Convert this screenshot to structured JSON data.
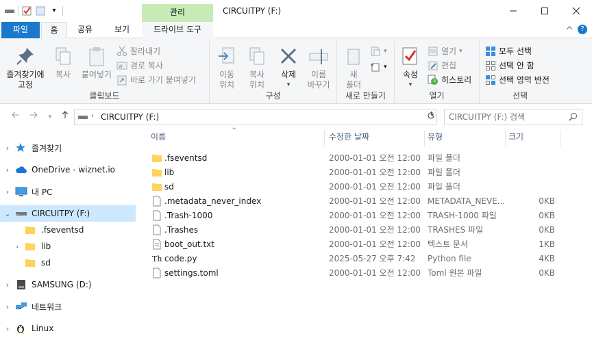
{
  "window": {
    "title": "CIRCUITPY (F:)",
    "context_tab": "관리",
    "controls": [
      "minimize",
      "maximize",
      "close"
    ]
  },
  "ribbon_tabs": {
    "file": "파일",
    "home": "홈",
    "share": "공유",
    "view": "보기",
    "drive_tools": "드라이브 도구"
  },
  "clipboard": {
    "pin": "즐겨찾기에\n고정",
    "copy": "복사",
    "paste": "붙여넣기",
    "cut": "잘라내기",
    "copy_path": "경로 복사",
    "paste_shortcut": "바로 가기 붙여넣기",
    "label": "클립보드"
  },
  "organize": {
    "move_to": "이동\n위치",
    "copy_to": "복사\n위치",
    "delete": "삭제",
    "rename": "이름\n바꾸기",
    "label": "구성"
  },
  "new": {
    "new_folder": "새\n폴더",
    "label": "새로 만들기"
  },
  "open": {
    "properties": "속성",
    "open": "열기",
    "edit": "편집",
    "history": "히스토리",
    "label": "열기"
  },
  "select": {
    "select_all": "모두 선택",
    "select_none": "선택 안 함",
    "invert": "선택 영역 반전",
    "label": "선택"
  },
  "address": {
    "path": "CIRCUITPY (F:)",
    "search_placeholder": "CIRCUITPY (F:) 검색"
  },
  "nav_pane": [
    {
      "label": "즐겨찾기",
      "icon": "star-icon",
      "indent": 0,
      "expandable": true
    },
    {
      "label": "OneDrive - wiznet.io",
      "icon": "cloud-icon",
      "indent": 0,
      "expandable": true
    },
    {
      "label": "내 PC",
      "icon": "pc-icon",
      "indent": 0,
      "expandable": true
    },
    {
      "label": "CIRCUITPY (F:)",
      "icon": "drive-icon",
      "indent": 0,
      "expanded": true,
      "selected": true
    },
    {
      "label": ".fseventsd",
      "icon": "folder-icon",
      "indent": 1
    },
    {
      "label": "lib",
      "icon": "folder-icon",
      "indent": 1,
      "expandable": true
    },
    {
      "label": "sd",
      "icon": "folder-icon",
      "indent": 1
    },
    {
      "label": "SAMSUNG (D:)",
      "icon": "drive-icon",
      "indent": 0,
      "expandable": true
    },
    {
      "label": "네트워크",
      "icon": "network-icon",
      "indent": 0,
      "expandable": true
    },
    {
      "label": "Linux",
      "icon": "linux-icon",
      "indent": 0,
      "expandable": true
    }
  ],
  "columns": {
    "name": "이름",
    "date": "수정한 날짜",
    "type": "유형",
    "size": "크기"
  },
  "files": [
    {
      "name": ".fseventsd",
      "date": "2000-01-01 오전 12:00",
      "type": "파일 폴더",
      "size": "",
      "kind": "folder"
    },
    {
      "name": "lib",
      "date": "2000-01-01 오전 12:00",
      "type": "파일 폴더",
      "size": "",
      "kind": "folder"
    },
    {
      "name": "sd",
      "date": "2000-01-01 오전 12:00",
      "type": "파일 폴더",
      "size": "",
      "kind": "folder"
    },
    {
      "name": ".metadata_never_index",
      "date": "2000-01-01 오전 12:00",
      "type": "METADATA_NEVE...",
      "size": "0KB",
      "kind": "file"
    },
    {
      "name": ".Trash-1000",
      "date": "2000-01-01 오전 12:00",
      "type": "TRASH-1000 파일",
      "size": "0KB",
      "kind": "file"
    },
    {
      "name": ".Trashes",
      "date": "2000-01-01 오전 12:00",
      "type": "TRASHES 파일",
      "size": "0KB",
      "kind": "file"
    },
    {
      "name": "boot_out.txt",
      "date": "2000-01-01 오전 12:00",
      "type": "텍스트 문서",
      "size": "1KB",
      "kind": "text"
    },
    {
      "name": "code.py",
      "date": "2025-05-27 오후 7:42",
      "type": "Python file",
      "size": "4KB",
      "kind": "python"
    },
    {
      "name": "settings.toml",
      "date": "2000-01-01 오전 12:00",
      "type": "Toml 원본 파일",
      "size": "0KB",
      "kind": "file"
    }
  ],
  "colors": {
    "accent": "#1979ca",
    "context_tab": "#c7eab6",
    "selected": "#cce8ff",
    "folder": "#ffd35b"
  }
}
